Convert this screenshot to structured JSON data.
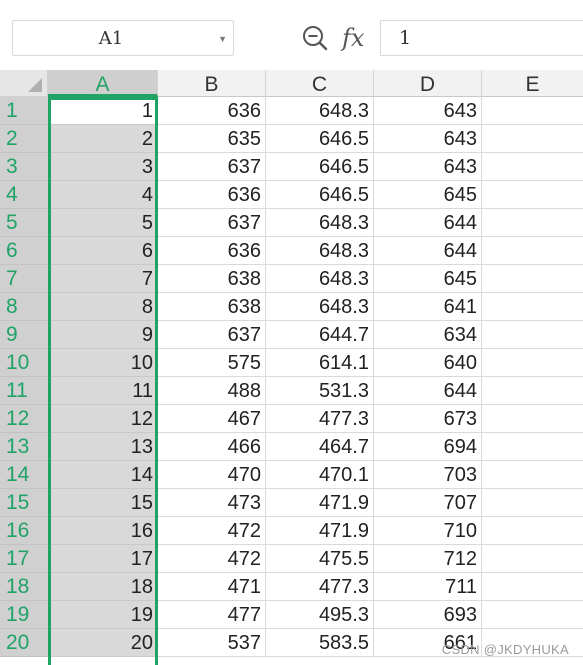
{
  "formula_bar": {
    "name_box": "A1",
    "fx_label": "fx",
    "formula_value": "1"
  },
  "columns": [
    "A",
    "B",
    "C",
    "D",
    "E"
  ],
  "active_column": "A",
  "rows": [
    {
      "num": "1",
      "A": "1",
      "B": "636",
      "C": "648.3",
      "D": "643",
      "E": ""
    },
    {
      "num": "2",
      "A": "2",
      "B": "635",
      "C": "646.5",
      "D": "643",
      "E": ""
    },
    {
      "num": "3",
      "A": "3",
      "B": "637",
      "C": "646.5",
      "D": "643",
      "E": ""
    },
    {
      "num": "4",
      "A": "4",
      "B": "636",
      "C": "646.5",
      "D": "645",
      "E": ""
    },
    {
      "num": "5",
      "A": "5",
      "B": "637",
      "C": "648.3",
      "D": "644",
      "E": ""
    },
    {
      "num": "6",
      "A": "6",
      "B": "636",
      "C": "648.3",
      "D": "644",
      "E": ""
    },
    {
      "num": "7",
      "A": "7",
      "B": "638",
      "C": "648.3",
      "D": "645",
      "E": ""
    },
    {
      "num": "8",
      "A": "8",
      "B": "638",
      "C": "648.3",
      "D": "641",
      "E": ""
    },
    {
      "num": "9",
      "A": "9",
      "B": "637",
      "C": "644.7",
      "D": "634",
      "E": ""
    },
    {
      "num": "10",
      "A": "10",
      "B": "575",
      "C": "614.1",
      "D": "640",
      "E": ""
    },
    {
      "num": "11",
      "A": "11",
      "B": "488",
      "C": "531.3",
      "D": "644",
      "E": ""
    },
    {
      "num": "12",
      "A": "12",
      "B": "467",
      "C": "477.3",
      "D": "673",
      "E": ""
    },
    {
      "num": "13",
      "A": "13",
      "B": "466",
      "C": "464.7",
      "D": "694",
      "E": ""
    },
    {
      "num": "14",
      "A": "14",
      "B": "470",
      "C": "470.1",
      "D": "703",
      "E": ""
    },
    {
      "num": "15",
      "A": "15",
      "B": "473",
      "C": "471.9",
      "D": "707",
      "E": ""
    },
    {
      "num": "16",
      "A": "16",
      "B": "472",
      "C": "471.9",
      "D": "710",
      "E": ""
    },
    {
      "num": "17",
      "A": "17",
      "B": "472",
      "C": "475.5",
      "D": "712",
      "E": ""
    },
    {
      "num": "18",
      "A": "18",
      "B": "471",
      "C": "477.3",
      "D": "711",
      "E": ""
    },
    {
      "num": "19",
      "A": "19",
      "B": "477",
      "C": "495.3",
      "D": "693",
      "E": ""
    },
    {
      "num": "20",
      "A": "20",
      "B": "537",
      "C": "583.5",
      "D": "661",
      "E": ""
    }
  ],
  "watermark": "CSDN @JKDYHUKA",
  "colors": {
    "accent": "#21a366",
    "header_bg": "#f2f2f2",
    "selected_column_bg": "#d9d9d9"
  }
}
